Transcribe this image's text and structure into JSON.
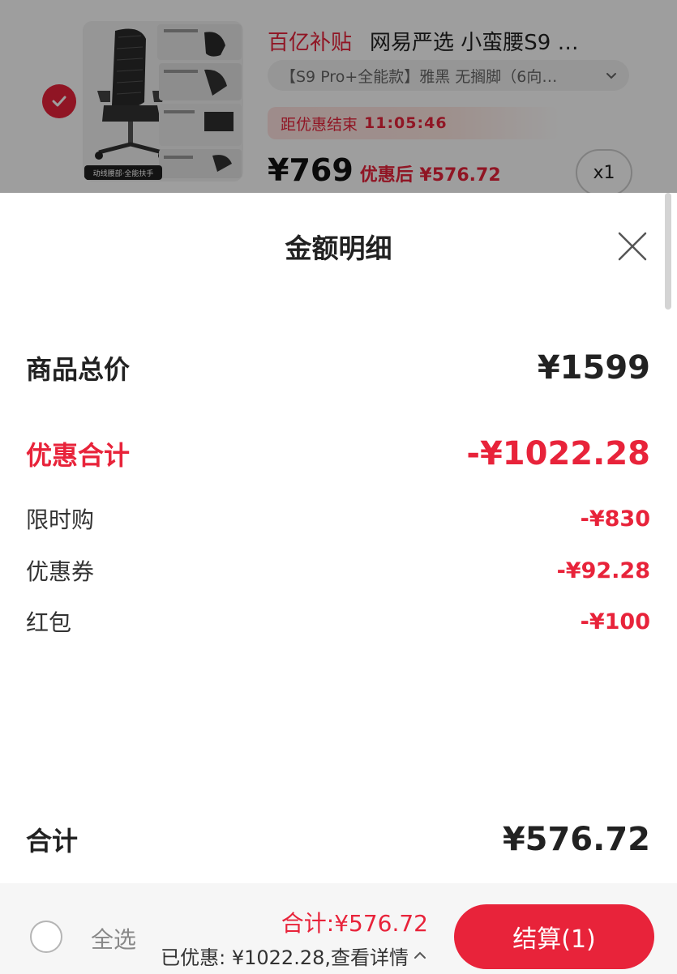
{
  "cart_item": {
    "selected": true,
    "subsidy_tag": "百亿补贴",
    "title": "网易严选 小蛮腰S9 …",
    "sku": "【S9 Pro+全能款】雅黑 无搁脚（6向…",
    "countdown_label": "距优惠结束",
    "countdown_time": "11:05:46",
    "price": "¥769",
    "after_discount_price": "优惠后 ¥576.72",
    "quantity": "x1",
    "thumbnail_caption": "动线腰部·全能扶手"
  },
  "sheet": {
    "title": "金额明细",
    "total_label": "商品总价",
    "total_value": "¥1599",
    "discount_label": "优惠合计",
    "discount_value": "-¥1022.28",
    "discount_items": [
      {
        "label": "限时购",
        "value": "-¥830"
      },
      {
        "label": "优惠券",
        "value": "-¥92.28"
      },
      {
        "label": "红包",
        "value": "-¥100"
      }
    ],
    "grand_label": "合计",
    "grand_value": "¥576.72"
  },
  "footer": {
    "select_all_label": "全选",
    "total_text": "合计:¥576.72",
    "saved_text": "已优惠: ¥1022.28,查看详情",
    "checkout_label": "结算(1)"
  },
  "colors": {
    "accent": "#e8233a",
    "text": "#222222",
    "overlay": "rgba(0,0,0,0.38)"
  }
}
